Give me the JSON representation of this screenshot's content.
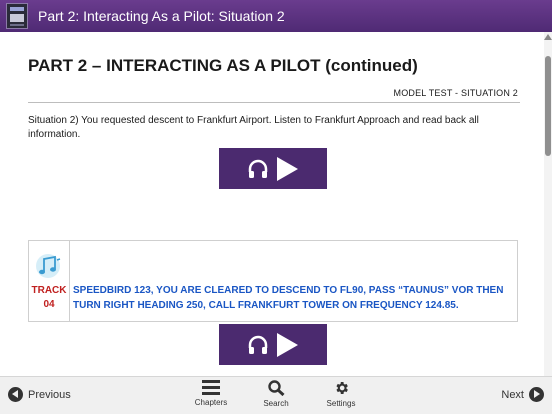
{
  "window": {
    "title": "Part 2: Interacting As a Pilot: Situation 2"
  },
  "page": {
    "title": "PART 2 – INTERACTING AS A PILOT (continued)",
    "subtitle": "MODEL TEST - SITUATION 2",
    "instruction": "Situation 2) You requested descent to Frankfurt Airport. Listen to Frankfurt Approach and read back all information."
  },
  "track": {
    "label": "TRACK",
    "number": "04",
    "transcript": "SPEEDBIRD 123, YOU ARE CLEARED TO DESCEND TO FL90, PASS “TAUNUS” VOR THEN TURN RIGHT HEADING 250, CALL FRANKFURT TOWER ON FREQUENCY 124.85."
  },
  "nav": {
    "previous": "Previous",
    "next": "Next",
    "chapters": "Chapters",
    "search": "Search",
    "settings": "Settings"
  },
  "icons": {
    "app": "app-icon",
    "audio_play": "headphones-play-icon",
    "music_note": "music-note-icon",
    "previous": "circle-arrow-left-icon",
    "next": "circle-arrow-right-icon",
    "chapters": "menu-icon",
    "search": "search-icon",
    "settings": "gear-icon"
  },
  "colors": {
    "titlebar": "#5a3380",
    "play_button": "#4b2a6f",
    "track_label": "#c0201f",
    "transcript": "#1a56c4"
  }
}
